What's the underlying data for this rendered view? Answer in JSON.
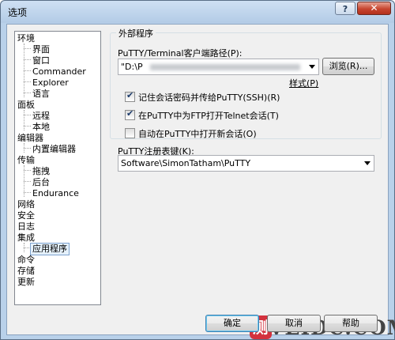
{
  "window": {
    "title": "选项",
    "help_label": "?",
    "close_label": "✕"
  },
  "tree": {
    "items": [
      {
        "label": "环境"
      },
      {
        "label": "界面"
      },
      {
        "label": "窗口"
      },
      {
        "label": "Commander"
      },
      {
        "label": "Explorer"
      },
      {
        "label": "语言"
      },
      {
        "label": "面板"
      },
      {
        "label": "远程"
      },
      {
        "label": "本地"
      },
      {
        "label": "编辑器"
      },
      {
        "label": "内置编辑器"
      },
      {
        "label": "传输"
      },
      {
        "label": "拖拽"
      },
      {
        "label": "后台"
      },
      {
        "label": "Endurance"
      },
      {
        "label": "网络"
      },
      {
        "label": "安全"
      },
      {
        "label": "日志"
      },
      {
        "label": "集成"
      },
      {
        "label": "应用程序"
      },
      {
        "label": "命令"
      },
      {
        "label": "存储"
      },
      {
        "label": "更新"
      }
    ],
    "selected": "应用程序"
  },
  "group": {
    "title": "外部程序",
    "path_label": "PuTTY/Terminal客户端路径(P):",
    "path_value": "\"D:\\P",
    "browse_label": "浏览(R)...",
    "pattern_label": "样式(P)",
    "checkbox_remember": {
      "label": "记住会话密码并传给PuTTY(SSH)(R)",
      "checked": true
    },
    "checkbox_telnet": {
      "label": "在PuTTY中为FTP打开Telnet会话(T)",
      "checked": true
    },
    "checkbox_autoopen": {
      "label": "自动在PuTTY中打开新会话(O)",
      "checked": false
    }
  },
  "registry": {
    "label": "PuTTY注册表键(K):",
    "value": "Software\\SimonTatham\\PuTTY"
  },
  "buttons": {
    "ok": "确定",
    "cancel": "取消",
    "help": "帮助"
  },
  "watermark": {
    "logo_char": "测",
    "text": "VEIDC.COM"
  },
  "colors": {
    "window_frame": "#b9d1ea",
    "client_bg": "#f0f0f0",
    "close_red": "#c7452f"
  }
}
